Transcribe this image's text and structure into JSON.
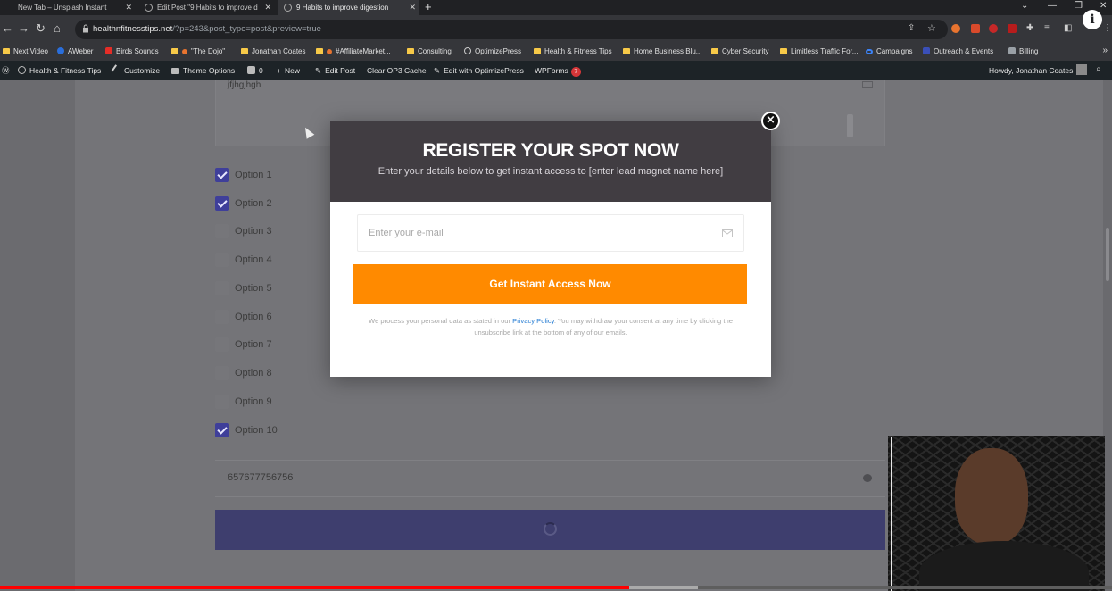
{
  "browser": {
    "tabs": [
      {
        "label": "New Tab – Unsplash Instant",
        "active": false
      },
      {
        "label": "Edit Post \"9 Habits to improve d",
        "active": false
      },
      {
        "label": "9 Habits to improve digestion",
        "active": true
      }
    ],
    "new_tab_symbol": "+",
    "url_host": "healthnfitnesstips.net",
    "url_path": "/?p=243&post_type=post&preview=true",
    "bookmarks": [
      {
        "label": "Next Video",
        "icon": "folder-icon"
      },
      {
        "label": "AWeber",
        "icon": "aweber-icon"
      },
      {
        "label": "Birds Sounds",
        "icon": "youtube-icon"
      },
      {
        "label": "\"The Dojo\"",
        "icon": "folder-icon"
      },
      {
        "label": "Jonathan Coates",
        "icon": "folder-icon"
      },
      {
        "label": "#AffiliateMarket...",
        "icon": "folder-icon"
      },
      {
        "label": "Consulting",
        "icon": "folder-icon"
      },
      {
        "label": "OptimizePress",
        "icon": "globe-icon"
      },
      {
        "label": "Health & Fitness Tips",
        "icon": "folder-icon"
      },
      {
        "label": "Home Business Blu...",
        "icon": "folder-icon"
      },
      {
        "label": "Cyber Security",
        "icon": "folder-icon"
      },
      {
        "label": "Limitless Traffic For...",
        "icon": "folder-icon"
      },
      {
        "label": "Campaigns",
        "icon": "meta-icon"
      },
      {
        "label": "Outreach & Events",
        "icon": "va-icon"
      },
      {
        "label": "Billing",
        "icon": "billing-icon"
      }
    ],
    "colors": {
      "chrome_dark": "#202124",
      "chrome_mid": "#35363a",
      "folder": "#f7c948"
    }
  },
  "adminbar": {
    "items": [
      {
        "label": "Health & Fitness Tips",
        "icon": "dashboard-icon"
      },
      {
        "label": "Customize",
        "icon": "paintbrush-icon"
      },
      {
        "label": "Theme Options",
        "icon": "folder-icon"
      },
      {
        "label": "0",
        "icon": "comment-icon"
      },
      {
        "label": "New",
        "icon": "plus-icon"
      },
      {
        "label": "Edit Post",
        "icon": "pencil-icon"
      },
      {
        "label": "Clear OP3 Cache",
        "icon": ""
      },
      {
        "label": "Edit with OptimizePress",
        "icon": "pencil-icon"
      },
      {
        "label": "WPForms",
        "icon": ""
      }
    ],
    "wpforms_count": "7",
    "howdy": "Howdy, Jonathan Coates"
  },
  "page": {
    "textarea_value": "jfjhgjhgh",
    "options": [
      {
        "label": "Option 1",
        "checked": true
      },
      {
        "label": "Option 2",
        "checked": true
      },
      {
        "label": "Option 3",
        "checked": false
      },
      {
        "label": "Option 4",
        "checked": false
      },
      {
        "label": "Option 5",
        "checked": false
      },
      {
        "label": "Option 6",
        "checked": false
      },
      {
        "label": "Option 7",
        "checked": false
      },
      {
        "label": "Option 8",
        "checked": false
      },
      {
        "label": "Option 9",
        "checked": false
      },
      {
        "label": "Option 10",
        "checked": true
      }
    ],
    "phone_value": "657677756756"
  },
  "modal": {
    "title": "REGISTER YOUR SPOT NOW",
    "subtitle": "Enter your details below to get instant access to [enter lead magnet name here]",
    "email_placeholder": "Enter your e-mail",
    "cta_label": "Get Instant Access Now",
    "consent_before": "We process your personal data as stated in our ",
    "consent_link": "Privacy Policy",
    "consent_after": ". You may withdraw your consent at any time by clicking the unsubscribe link at the bottom of any of our emails.",
    "close_symbol": "×",
    "colors": {
      "header": "#413d42",
      "cta": "#ff8a00",
      "link": "#2a7fd4"
    }
  },
  "video": {
    "played_fraction": 0.566,
    "buffered_fraction": 0.628,
    "played_color": "#ff0000"
  }
}
